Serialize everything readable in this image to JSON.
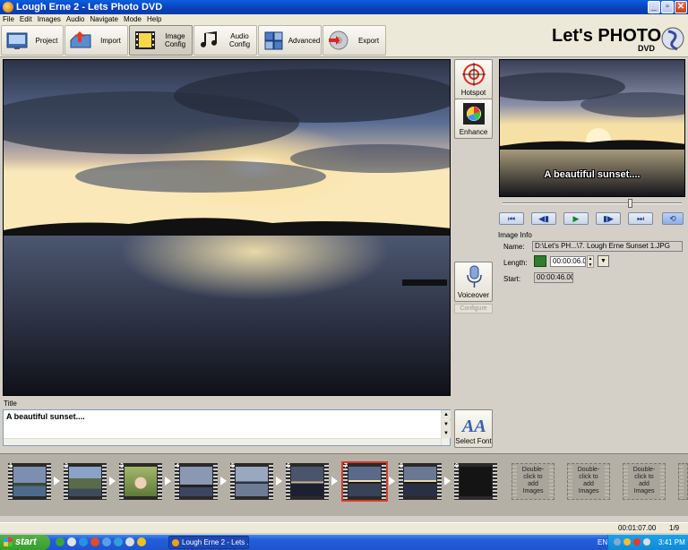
{
  "window": {
    "title": "Lough Erne 2 - Lets Photo DVD",
    "controls": [
      "_",
      "▫",
      "✕"
    ]
  },
  "menu": [
    "File",
    "Edit",
    "Images",
    "Audio",
    "Navigate",
    "Mode",
    "Help"
  ],
  "toolbar": {
    "project": "Project",
    "import": "Import",
    "image_config": "Image Config",
    "audio_config": "Audio Config",
    "advanced": "Advanced",
    "export": "Export"
  },
  "logo": {
    "main": "Let's PHOTO",
    "sub": "DVD"
  },
  "side_buttons": {
    "hotspot": "Hotspot",
    "enhance": "Enhance",
    "voiceover": "Voiceover",
    "configure": "Configure",
    "select_font": "Select Font"
  },
  "preview": {
    "caption": "A beautiful sunset....",
    "scrub_position": 0.72
  },
  "transport": [
    "⏮",
    "◀▮",
    "▶",
    "▮▶",
    "⏭",
    "⟲"
  ],
  "image_info": {
    "heading": "Image Info",
    "name_label": "Name:",
    "name_value": "D:\\Let's PH...\\7. Lough Erne Sunset 1.JPG",
    "length_label": "Length:",
    "length_value": "00:00:06.00",
    "start_label": "Start:",
    "start_value": "00:00:46.00"
  },
  "title_panel": {
    "label": "Title",
    "text": "A beautiful sunset...."
  },
  "filmstrip": {
    "slots": [
      {
        "num": "1"
      },
      {
        "num": "2"
      },
      {
        "num": "3"
      },
      {
        "num": "4"
      },
      {
        "num": "5"
      },
      {
        "num": "6"
      },
      {
        "num": "7"
      },
      {
        "num": "8"
      },
      {
        "num": "9"
      }
    ],
    "empty_text": "Double-click to add Images"
  },
  "status": {
    "time": "00:01:07.00",
    "count": "1/9"
  },
  "taskbar": {
    "start": "start",
    "task": "Lough Erne 2 - Lets ...",
    "lang": "EN",
    "clock": "3:41 PM"
  },
  "colors": {
    "selected_slot": "#d63b2a",
    "titlebar": "#0a3fb8"
  }
}
